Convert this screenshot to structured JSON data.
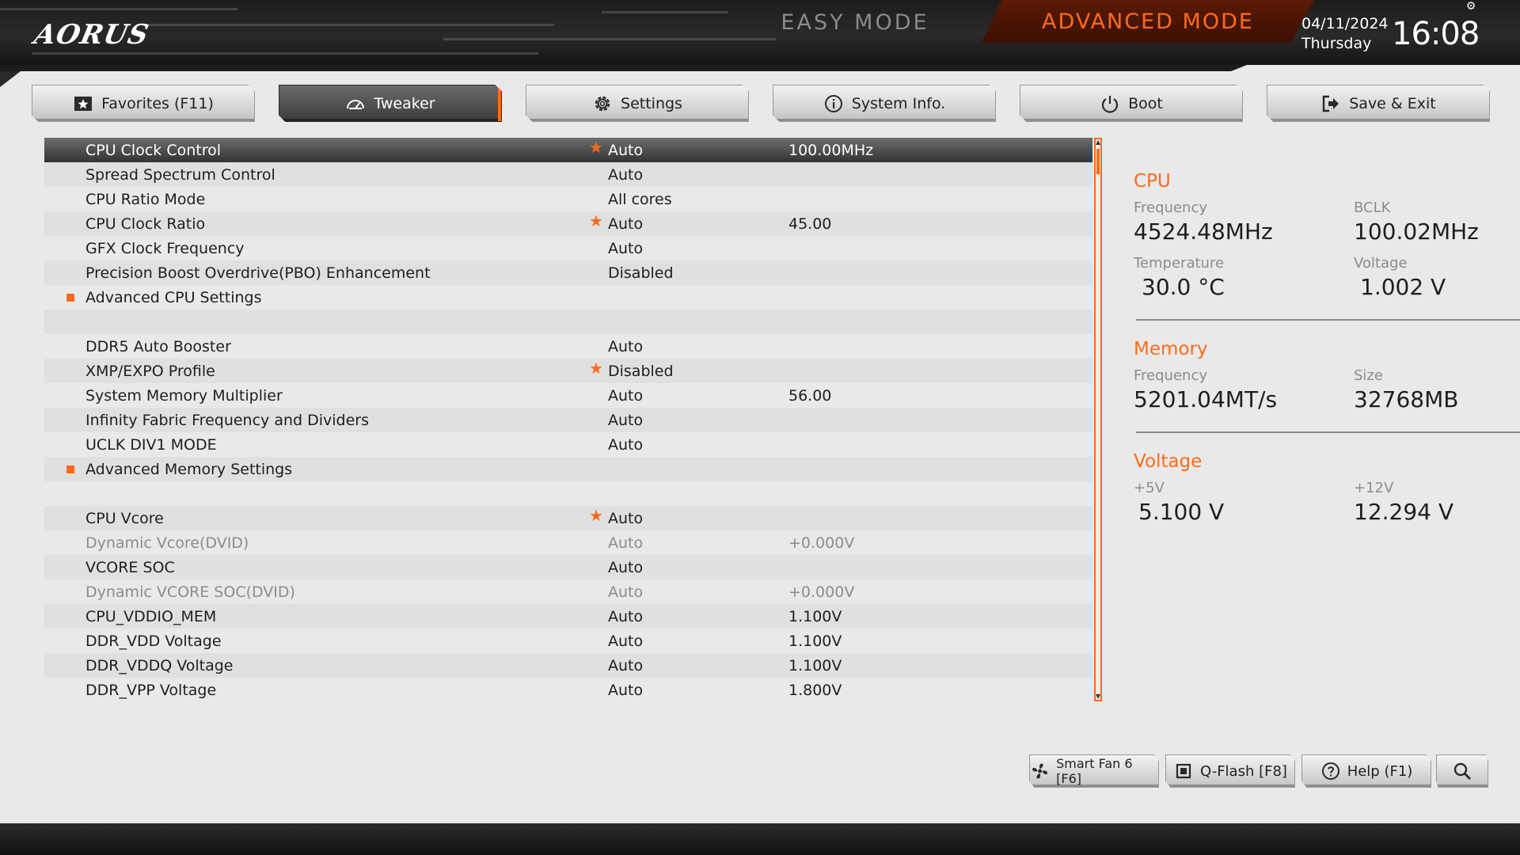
{
  "header": {
    "logo": "AORUS",
    "easy_mode_label": "EASY MODE",
    "advanced_mode_label": "ADVANCED MODE",
    "date": "04/11/2024",
    "day": "Thursday",
    "time": "16:08"
  },
  "tabs": [
    {
      "label": "Favorites (F11)",
      "icon": "star-icon",
      "active": false
    },
    {
      "label": "Tweaker",
      "icon": "speedometer-icon",
      "active": true
    },
    {
      "label": "Settings",
      "icon": "gear-icon",
      "active": false
    },
    {
      "label": "System Info.",
      "icon": "info-icon",
      "active": false
    },
    {
      "label": "Boot",
      "icon": "power-icon",
      "active": false
    },
    {
      "label": "Save & Exit",
      "icon": "exit-icon",
      "active": false
    }
  ],
  "settings": [
    {
      "name": "CPU Clock Control",
      "value": "Auto",
      "extra": "100.00MHz",
      "star": true,
      "selected": true
    },
    {
      "name": "Spread Spectrum Control",
      "value": "Auto",
      "extra": ""
    },
    {
      "name": "CPU Ratio Mode",
      "value": "All cores",
      "extra": ""
    },
    {
      "name": "CPU Clock Ratio",
      "value": "Auto",
      "extra": "45.00",
      "star": true
    },
    {
      "name": "GFX Clock Frequency",
      "value": "Auto",
      "extra": ""
    },
    {
      "name": "Precision Boost Overdrive(PBO) Enhancement",
      "value": "Disabled",
      "extra": ""
    },
    {
      "name": "Advanced CPU Settings",
      "value": "",
      "extra": "",
      "submenu": true
    },
    {
      "name": "",
      "value": "",
      "extra": "",
      "blank": true
    },
    {
      "name": "DDR5 Auto Booster",
      "value": "Auto",
      "extra": ""
    },
    {
      "name": "XMP/EXPO Profile",
      "value": "Disabled",
      "extra": "",
      "star": true
    },
    {
      "name": "System Memory Multiplier",
      "value": "Auto",
      "extra": "56.00"
    },
    {
      "name": "Infinity Fabric Frequency and Dividers",
      "value": "Auto",
      "extra": ""
    },
    {
      "name": "UCLK DIV1 MODE",
      "value": "Auto",
      "extra": ""
    },
    {
      "name": "Advanced Memory Settings",
      "value": "",
      "extra": "",
      "submenu": true
    },
    {
      "name": "",
      "value": "",
      "extra": "",
      "blank": true
    },
    {
      "name": "CPU Vcore",
      "value": "Auto",
      "extra": "",
      "star": true
    },
    {
      "name": "Dynamic Vcore(DVID)",
      "value": "Auto",
      "extra": "+0.000V",
      "dim": true
    },
    {
      "name": "VCORE SOC",
      "value": "Auto",
      "extra": ""
    },
    {
      "name": "Dynamic VCORE SOC(DVID)",
      "value": "Auto",
      "extra": "+0.000V",
      "dim": true
    },
    {
      "name": "CPU_VDDIO_MEM",
      "value": "Auto",
      "extra": "1.100V"
    },
    {
      "name": "DDR_VDD Voltage",
      "value": "Auto",
      "extra": "1.100V"
    },
    {
      "name": "DDR_VDDQ Voltage",
      "value": "Auto",
      "extra": "1.100V"
    },
    {
      "name": "DDR_VPP Voltage",
      "value": "Auto",
      "extra": "1.800V"
    }
  ],
  "info": {
    "cpu": {
      "title": "CPU",
      "frequency_label": "Frequency",
      "frequency": "4524.48MHz",
      "bclk_label": "BCLK",
      "bclk": "100.02MHz",
      "temperature_label": "Temperature",
      "temperature": "30.0 °C",
      "voltage_label": "Voltage",
      "voltage": "1.002 V"
    },
    "memory": {
      "title": "Memory",
      "frequency_label": "Frequency",
      "frequency": "5201.04MT/s",
      "size_label": "Size",
      "size": "32768MB"
    },
    "voltage": {
      "title": "Voltage",
      "v5_label": "+5V",
      "v5": "5.100 V",
      "v12_label": "+12V",
      "v12": "12.294 V"
    }
  },
  "bottom_buttons": {
    "smart_fan": "Smart Fan 6 [F6]",
    "qflash": "Q-Flash [F8]",
    "help": "Help (F1)"
  },
  "colors": {
    "accent": "#ff6a1a",
    "background": "#e9e9e9",
    "selected_row": "#4a4a4a"
  }
}
